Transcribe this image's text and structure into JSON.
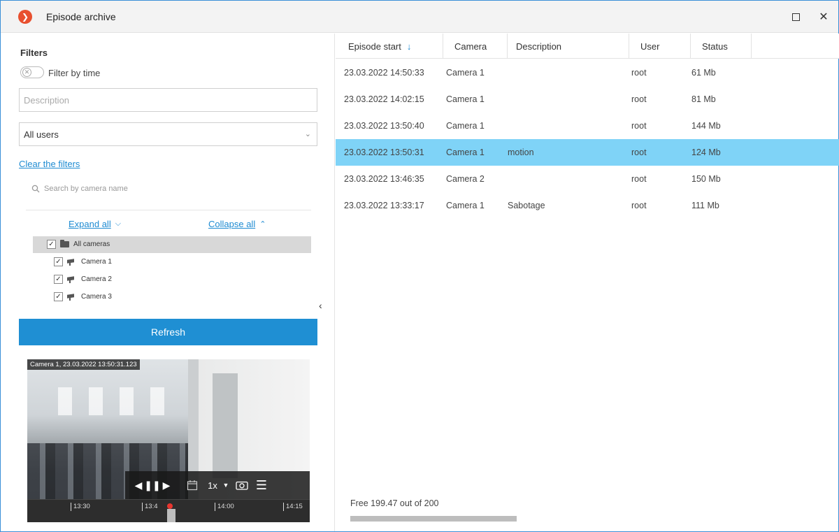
{
  "window": {
    "title": "Episode archive",
    "logo_glyph": "❯"
  },
  "filters": {
    "title": "Filters",
    "filter_by_time_label": "Filter by time",
    "description_placeholder": "Description",
    "users_select_value": "All users",
    "clear_filters": "Clear the filters",
    "camera_search_placeholder": "Search by camera name",
    "expand_all": "Expand all",
    "collapse_all": "Collapse all",
    "tree": {
      "root": "All cameras",
      "cameras": [
        "Camera 1",
        "Camera 2",
        "Camera 3"
      ]
    },
    "refresh_label": "Refresh"
  },
  "player": {
    "caption": "Camera 1, 23.03.2022 13:50:31.123",
    "speed": "1x",
    "timeline_ticks": [
      "13:30",
      "13:4",
      "14:00",
      "14:15"
    ]
  },
  "table": {
    "columns": [
      "Episode start",
      "Camera",
      "Description",
      "User",
      "Status"
    ],
    "rows": [
      [
        "23.03.2022 14:50:33",
        "Camera 1",
        "",
        "root",
        "61 Mb"
      ],
      [
        "23.03.2022 14:02:15",
        "Camera 1",
        "",
        "root",
        "81 Mb"
      ],
      [
        "23.03.2022 13:50:40",
        "Camera 1",
        "",
        "root",
        "144 Mb"
      ],
      [
        "23.03.2022 13:50:31",
        "Camera 1",
        "motion",
        "root",
        "124 Mb"
      ],
      [
        "23.03.2022 13:46:35",
        "Camera 2",
        "",
        "root",
        "150 Mb"
      ],
      [
        "23.03.2022 13:33:17",
        "Camera 1",
        "Sabotage",
        "root",
        "111 Mb"
      ]
    ],
    "selected_row": 3
  },
  "storage": {
    "text": "Free 199.47 out of 200",
    "used_fraction": 1.0
  },
  "colors": {
    "accent": "#1f8fd3",
    "selected_row": "#7fd3f7",
    "logo": "#e8502f",
    "marker": "#e8352f"
  }
}
